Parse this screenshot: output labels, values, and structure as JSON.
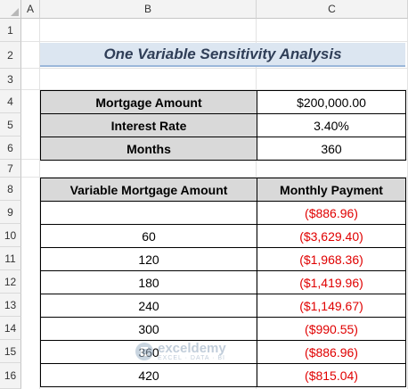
{
  "columns": [
    "A",
    "B",
    "C"
  ],
  "rows": [
    "1",
    "2",
    "3",
    "4",
    "5",
    "6",
    "7",
    "8",
    "9",
    "10",
    "11",
    "12",
    "13",
    "14",
    "15",
    "16"
  ],
  "title": "One Variable Sensitivity Analysis",
  "inputs": [
    {
      "label": "Mortgage Amount",
      "value": "$200,000.00"
    },
    {
      "label": "Interest Rate",
      "value": "3.40%"
    },
    {
      "label": "Months",
      "value": "360"
    }
  ],
  "table": {
    "headers": [
      "Variable Mortgage Amount",
      "Monthly Payment"
    ],
    "rows": [
      {
        "var": "",
        "payment": "($886.96)"
      },
      {
        "var": "60",
        "payment": "($3,629.40)"
      },
      {
        "var": "120",
        "payment": "($1,968.36)"
      },
      {
        "var": "180",
        "payment": "($1,419.96)"
      },
      {
        "var": "240",
        "payment": "($1,149.67)"
      },
      {
        "var": "300",
        "payment": "($990.55)"
      },
      {
        "var": "360",
        "payment": "($886.96)"
      },
      {
        "var": "420",
        "payment": "($815.04)"
      }
    ]
  },
  "watermark": {
    "name": "exceldemy",
    "tagline": "EXCEL · DATA · BI"
  },
  "colors": {
    "negative": "#e00000",
    "title_fill": "#dce6f1",
    "label_fill": "#d9d9d9"
  }
}
